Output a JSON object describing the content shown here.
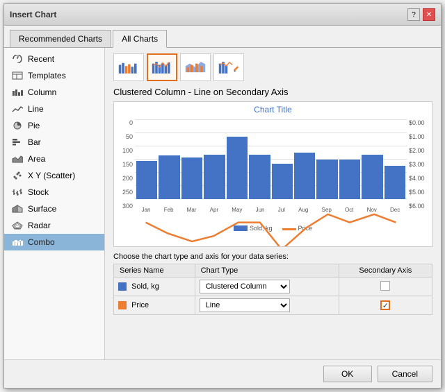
{
  "dialog": {
    "title": "Insert Chart",
    "tabs": [
      {
        "label": "Recommended Charts",
        "id": "recommended"
      },
      {
        "label": "All Charts",
        "id": "all",
        "active": true
      }
    ]
  },
  "sidebar": {
    "items": [
      {
        "label": "Recent",
        "icon": "recent-icon",
        "active": false
      },
      {
        "label": "Templates",
        "icon": "templates-icon",
        "active": false
      },
      {
        "label": "Column",
        "icon": "column-icon",
        "active": false
      },
      {
        "label": "Line",
        "icon": "line-icon",
        "active": false
      },
      {
        "label": "Pie",
        "icon": "pie-icon",
        "active": false
      },
      {
        "label": "Bar",
        "icon": "bar-icon",
        "active": false
      },
      {
        "label": "Area",
        "icon": "area-icon",
        "active": false
      },
      {
        "label": "X Y (Scatter)",
        "icon": "scatter-icon",
        "active": false
      },
      {
        "label": "Stock",
        "icon": "stock-icon",
        "active": false
      },
      {
        "label": "Surface",
        "icon": "surface-icon",
        "active": false
      },
      {
        "label": "Radar",
        "icon": "radar-icon",
        "active": false
      },
      {
        "label": "Combo",
        "icon": "combo-icon",
        "active": true
      }
    ]
  },
  "chart_icons": [
    {
      "id": "combo1",
      "selected": false
    },
    {
      "id": "combo2",
      "selected": true
    },
    {
      "id": "combo3",
      "selected": false
    },
    {
      "id": "combo4",
      "selected": false
    }
  ],
  "chart_title_label": "Clustered Column - Line on Secondary Axis",
  "chart_preview": {
    "title": "Chart Title",
    "y_left_labels": [
      "0",
      "50",
      "100",
      "150",
      "200",
      "250",
      "300"
    ],
    "y_right_labels": [
      "$0.00",
      "$1.00",
      "$2.00",
      "$3.00",
      "$4.00",
      "$5.00",
      "$6.00"
    ],
    "x_labels": [
      "Jan",
      "Feb",
      "Mar",
      "Apr",
      "May",
      "Jun",
      "Jul",
      "Aug",
      "Sep",
      "Oct",
      "Nov",
      "Dec"
    ],
    "bar_heights_pct": [
      48,
      55,
      52,
      56,
      78,
      56,
      44,
      58,
      50,
      50,
      56,
      42
    ],
    "legend": [
      {
        "label": "Sold, kg",
        "color": "#4472c4"
      },
      {
        "label": "Price",
        "color": "#ed7d31"
      }
    ]
  },
  "data_series_section": {
    "label": "Choose the chart type and axis for your data series:",
    "columns": [
      "Series Name",
      "Chart Type",
      "Secondary Axis"
    ],
    "rows": [
      {
        "color": "#4472c4",
        "name": "Sold, kg",
        "chart_type": "Clustered Column",
        "secondary_axis": false
      },
      {
        "color": "#ed7d31",
        "name": "Price",
        "chart_type": "Line",
        "secondary_axis": true
      }
    ]
  },
  "footer": {
    "ok_label": "OK",
    "cancel_label": "Cancel"
  }
}
